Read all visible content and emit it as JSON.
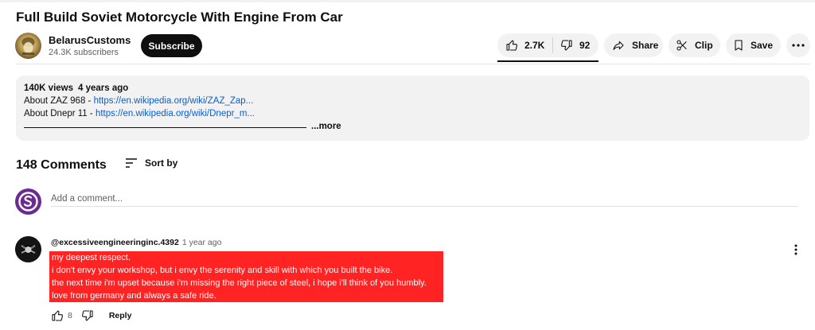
{
  "video": {
    "title": "Full Build Soviet Motorcycle With Engine From Car"
  },
  "channel": {
    "name": "BelarusCustoms",
    "subscribers": "24.3K subscribers",
    "subscribe_label": "Subscribe"
  },
  "actions": {
    "likes": "2.7K",
    "dislikes": "92",
    "share_label": "Share",
    "clip_label": "Clip",
    "save_label": "Save"
  },
  "description": {
    "views": "140K views",
    "age": "4 years ago",
    "line1_prefix": "About ZAZ 968 - ",
    "line1_link": "https://en.wikipedia.org/wiki/ZAZ_Zap...",
    "line2_prefix": "About Dnepr 11 - ",
    "line2_link": "https://en.wikipedia.org/wiki/Dnepr_m...",
    "more_label": "...more"
  },
  "comments": {
    "count_label": "148 Comments",
    "sort_label": "Sort by",
    "add_placeholder": "Add a comment...",
    "items": [
      {
        "author": "@excessiveengineeringinc.4392",
        "time": "1 year ago",
        "lines": [
          "my deepest respect.",
          "i don't envy your workshop, but i envy the serenity and skill with which you built the bike.",
          "the next time i'm upset because i'm missing the right piece of steel, i hope i'll think of you humbly.",
          "love from germany and always a safe ride."
        ],
        "likes": "8",
        "reply_label": "Reply",
        "highlight_color": "#ff2323"
      }
    ]
  },
  "colors": {
    "link": "#065fd4",
    "subscribe_bg": "#0f0f0f",
    "pill_bg": "#f2f2f2",
    "my_avatar": "#6b2c91"
  }
}
